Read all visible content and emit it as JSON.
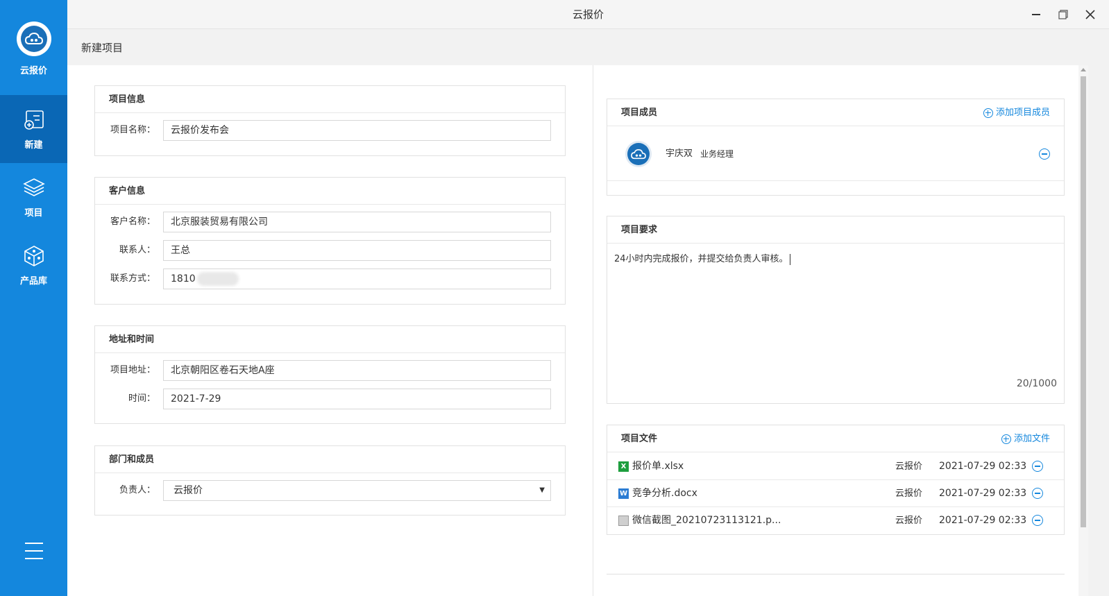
{
  "app": {
    "name": "云报价",
    "window_title": "云报价"
  },
  "sidebar": {
    "logo_label": "云报价",
    "items": [
      {
        "label": "新建",
        "icon": "new-project-icon",
        "active": true
      },
      {
        "label": "项目",
        "icon": "layers-icon",
        "active": false
      },
      {
        "label": "产品库",
        "icon": "box-icon",
        "active": false
      }
    ]
  },
  "page": {
    "title": "新建项目"
  },
  "project_info": {
    "heading": "项目信息",
    "name_label": "项目名称：",
    "name_value": "云报价发布会"
  },
  "customer_info": {
    "heading": "客户信息",
    "name_label": "客户名称：",
    "name_value": "北京服装贸易有限公司",
    "contact_label": "联系人：",
    "contact_value": "王总",
    "phone_label": "联系方式：",
    "phone_value": "1810"
  },
  "address_time": {
    "heading": "地址和时间",
    "address_label": "项目地址：",
    "address_value": "北京朝阳区卷石天地A座",
    "time_label": "时间：",
    "time_value": "2021-7-29"
  },
  "dept_members": {
    "heading": "部门和成员",
    "owner_label": "负责人：",
    "owner_value": "云报价"
  },
  "members": {
    "heading": "项目成员",
    "add_label": "添加项目成员",
    "list": [
      {
        "name": "宇庆双",
        "role": "业务经理"
      }
    ]
  },
  "requirements": {
    "heading": "项目要求",
    "text": "24小时内完成报价，并提交给负责人审核。",
    "counter": "20/1000"
  },
  "files": {
    "heading": "项目文件",
    "add_label": "添加文件",
    "list": [
      {
        "name": "报价单.xlsx",
        "owner": "云报价",
        "date": "2021-07-29 02:33",
        "type": "excel",
        "color": "#1e9e3e"
      },
      {
        "name": "竞争分析.docx",
        "owner": "云报价",
        "date": "2021-07-29 02:33",
        "type": "word",
        "color": "#2b7cd3"
      },
      {
        "name": "微信截图_20210723113121.p...",
        "owner": "云报价",
        "date": "2021-07-29 02:33",
        "type": "image",
        "color": "#9a9a9a"
      }
    ]
  },
  "colors": {
    "accent": "#1487dd",
    "sidebar_active": "#0a67b5"
  }
}
